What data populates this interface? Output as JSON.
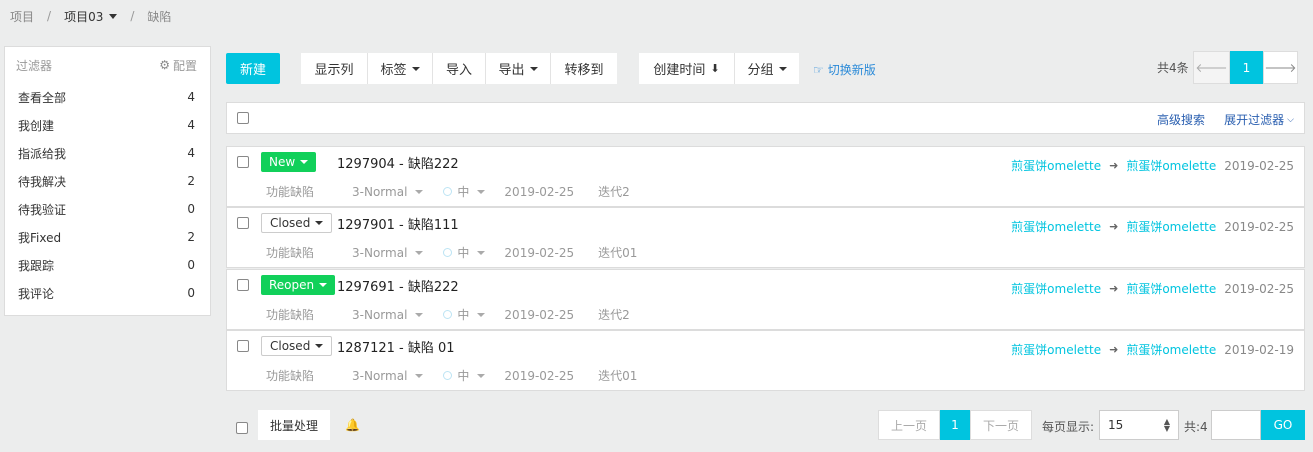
{
  "breadcrumb": {
    "root": "项目",
    "sep": "/",
    "project": "项目03",
    "current": "缺陷"
  },
  "sidebar": {
    "title": "过滤器",
    "config": "配置",
    "items": [
      {
        "label": "查看全部",
        "count": "4"
      },
      {
        "label": "我创建",
        "count": "4"
      },
      {
        "label": "指派给我",
        "count": "4"
      },
      {
        "label": "待我解决",
        "count": "2"
      },
      {
        "label": "待我验证",
        "count": "0"
      },
      {
        "label": "我Fixed",
        "count": "2"
      },
      {
        "label": "我跟踪",
        "count": "0"
      },
      {
        "label": "我评论",
        "count": "0"
      }
    ]
  },
  "toolbar": {
    "new": "新建",
    "columns": "显示列",
    "tags": "标签",
    "import": "导入",
    "export": "导出",
    "move": "转移到",
    "sort": "创建时间",
    "group": "分组",
    "switch": "切换新版",
    "total": "共4条",
    "page": "1"
  },
  "search": {
    "advanced": "高级搜索",
    "expand": "展开过滤器"
  },
  "rows": [
    {
      "status": "New",
      "title": "1297904 - 缺陷222",
      "type": "功能缺陷",
      "severity": "3-Normal",
      "priority": "中",
      "date": "2019-02-25",
      "iteration": "迭代2",
      "from": "煎蛋饼omelette",
      "to": "煎蛋饼omelette",
      "updated": "2019-02-25"
    },
    {
      "status": "Closed",
      "title": "1297901 - 缺陷111",
      "type": "功能缺陷",
      "severity": "3-Normal",
      "priority": "中",
      "date": "2019-02-25",
      "iteration": "迭代01",
      "from": "煎蛋饼omelette",
      "to": "煎蛋饼omelette",
      "updated": "2019-02-25"
    },
    {
      "status": "Reopen",
      "title": "1297691 - 缺陷222",
      "type": "功能缺陷",
      "severity": "3-Normal",
      "priority": "中",
      "date": "2019-02-25",
      "iteration": "迭代2",
      "from": "煎蛋饼omelette",
      "to": "煎蛋饼omelette",
      "updated": "2019-02-25"
    },
    {
      "status": "Closed",
      "title": "1287121 - 缺陷 01",
      "type": "功能缺陷",
      "severity": "3-Normal",
      "priority": "中",
      "date": "2019-02-25",
      "iteration": "迭代01",
      "from": "煎蛋饼omelette",
      "to": "煎蛋饼omelette",
      "updated": "2019-02-19"
    }
  ],
  "footer": {
    "batch": "批量处理",
    "prev": "上一页",
    "page": "1",
    "next": "下一页",
    "per_page_label": "每页显示:",
    "per_page": "15",
    "total": "共:4",
    "go": "GO"
  },
  "colors": {
    "accent": "#00c4df",
    "green": "#11d05a",
    "link": "#2a8ad8"
  }
}
